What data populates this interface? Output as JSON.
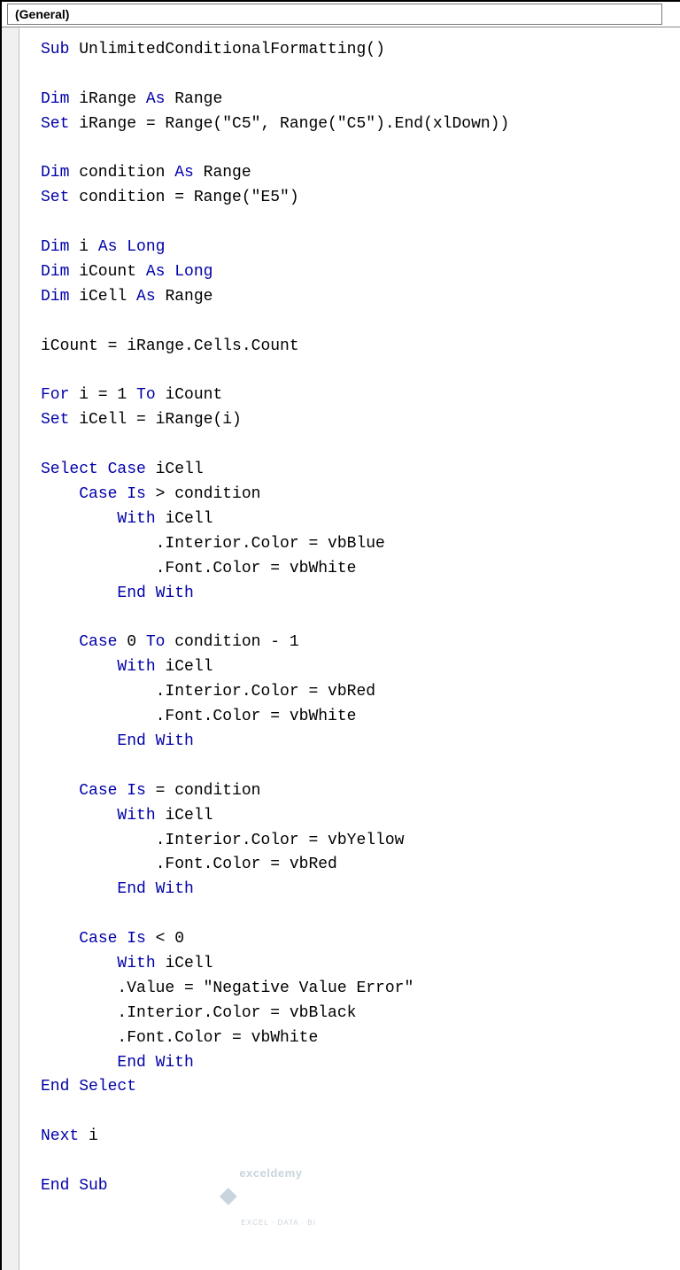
{
  "dropdown": {
    "selected": "(General)"
  },
  "code": {
    "tokens": [
      {
        "t": "Sub",
        "c": "kw"
      },
      {
        "t": " UnlimitedConditionalFormatting()"
      },
      {
        "br": 1
      },
      {
        "br": 1
      },
      {
        "t": "Dim",
        "c": "kw"
      },
      {
        "t": " iRange "
      },
      {
        "t": "As",
        "c": "kw"
      },
      {
        "t": " Range"
      },
      {
        "br": 1
      },
      {
        "t": "Set",
        "c": "kw"
      },
      {
        "t": " iRange = Range(\"C5\", Range(\"C5\").End(xlDown))"
      },
      {
        "br": 1
      },
      {
        "br": 1
      },
      {
        "t": "Dim",
        "c": "kw"
      },
      {
        "t": " condition "
      },
      {
        "t": "As",
        "c": "kw"
      },
      {
        "t": " Range"
      },
      {
        "br": 1
      },
      {
        "t": "Set",
        "c": "kw"
      },
      {
        "t": " condition = Range(\"E5\")"
      },
      {
        "br": 1
      },
      {
        "br": 1
      },
      {
        "t": "Dim",
        "c": "kw"
      },
      {
        "t": " i "
      },
      {
        "t": "As",
        "c": "kw"
      },
      {
        "t": " "
      },
      {
        "t": "Long",
        "c": "kw"
      },
      {
        "br": 1
      },
      {
        "t": "Dim",
        "c": "kw"
      },
      {
        "t": " iCount "
      },
      {
        "t": "As",
        "c": "kw"
      },
      {
        "t": " "
      },
      {
        "t": "Long",
        "c": "kw"
      },
      {
        "br": 1
      },
      {
        "t": "Dim",
        "c": "kw"
      },
      {
        "t": " iCell "
      },
      {
        "t": "As",
        "c": "kw"
      },
      {
        "t": " Range"
      },
      {
        "br": 1
      },
      {
        "br": 1
      },
      {
        "t": "iCount = iRange.Cells.Count"
      },
      {
        "br": 1
      },
      {
        "br": 1
      },
      {
        "t": "For",
        "c": "kw"
      },
      {
        "t": " i = 1 "
      },
      {
        "t": "To",
        "c": "kw"
      },
      {
        "t": " iCount"
      },
      {
        "br": 1
      },
      {
        "t": "Set",
        "c": "kw"
      },
      {
        "t": " iCell = iRange(i)"
      },
      {
        "br": 1
      },
      {
        "br": 1
      },
      {
        "t": "Select Case",
        "c": "kw"
      },
      {
        "t": " iCell"
      },
      {
        "br": 1
      },
      {
        "t": "    "
      },
      {
        "t": "Case Is",
        "c": "kw"
      },
      {
        "t": " > condition"
      },
      {
        "br": 1
      },
      {
        "t": "        "
      },
      {
        "t": "With",
        "c": "kw"
      },
      {
        "t": " iCell"
      },
      {
        "br": 1
      },
      {
        "t": "            .Interior.Color = vbBlue"
      },
      {
        "br": 1
      },
      {
        "t": "            .Font.Color = vbWhite"
      },
      {
        "br": 1
      },
      {
        "t": "        "
      },
      {
        "t": "End With",
        "c": "kw"
      },
      {
        "br": 1
      },
      {
        "br": 1
      },
      {
        "t": "    "
      },
      {
        "t": "Case",
        "c": "kw"
      },
      {
        "t": " 0 "
      },
      {
        "t": "To",
        "c": "kw"
      },
      {
        "t": " condition - 1"
      },
      {
        "br": 1
      },
      {
        "t": "        "
      },
      {
        "t": "With",
        "c": "kw"
      },
      {
        "t": " iCell"
      },
      {
        "br": 1
      },
      {
        "t": "            .Interior.Color = vbRed"
      },
      {
        "br": 1
      },
      {
        "t": "            .Font.Color = vbWhite"
      },
      {
        "br": 1
      },
      {
        "t": "        "
      },
      {
        "t": "End With",
        "c": "kw"
      },
      {
        "br": 1
      },
      {
        "br": 1
      },
      {
        "t": "    "
      },
      {
        "t": "Case Is",
        "c": "kw"
      },
      {
        "t": " = condition"
      },
      {
        "br": 1
      },
      {
        "t": "        "
      },
      {
        "t": "With",
        "c": "kw"
      },
      {
        "t": " iCell"
      },
      {
        "br": 1
      },
      {
        "t": "            .Interior.Color = vbYellow"
      },
      {
        "br": 1
      },
      {
        "t": "            .Font.Color = vbRed"
      },
      {
        "br": 1
      },
      {
        "t": "        "
      },
      {
        "t": "End With",
        "c": "kw"
      },
      {
        "br": 1
      },
      {
        "br": 1
      },
      {
        "t": "    "
      },
      {
        "t": "Case Is",
        "c": "kw"
      },
      {
        "t": " < 0"
      },
      {
        "br": 1
      },
      {
        "t": "        "
      },
      {
        "t": "With",
        "c": "kw"
      },
      {
        "t": " iCell"
      },
      {
        "br": 1
      },
      {
        "t": "        .Value = \"Negative Value Error\""
      },
      {
        "br": 1
      },
      {
        "t": "        .Interior.Color = vbBlack"
      },
      {
        "br": 1
      },
      {
        "t": "        .Font.Color = vbWhite"
      },
      {
        "br": 1
      },
      {
        "t": "        "
      },
      {
        "t": "End With",
        "c": "kw"
      },
      {
        "br": 1
      },
      {
        "t": "End Select",
        "c": "kw"
      },
      {
        "br": 1
      },
      {
        "br": 1
      },
      {
        "t": "Next",
        "c": "kw"
      },
      {
        "t": " i"
      },
      {
        "br": 1
      },
      {
        "br": 1
      },
      {
        "t": "End Sub",
        "c": "kw"
      }
    ]
  },
  "watermark": {
    "main": "exceldemy",
    "sub": "EXCEL · DATA · BI"
  }
}
